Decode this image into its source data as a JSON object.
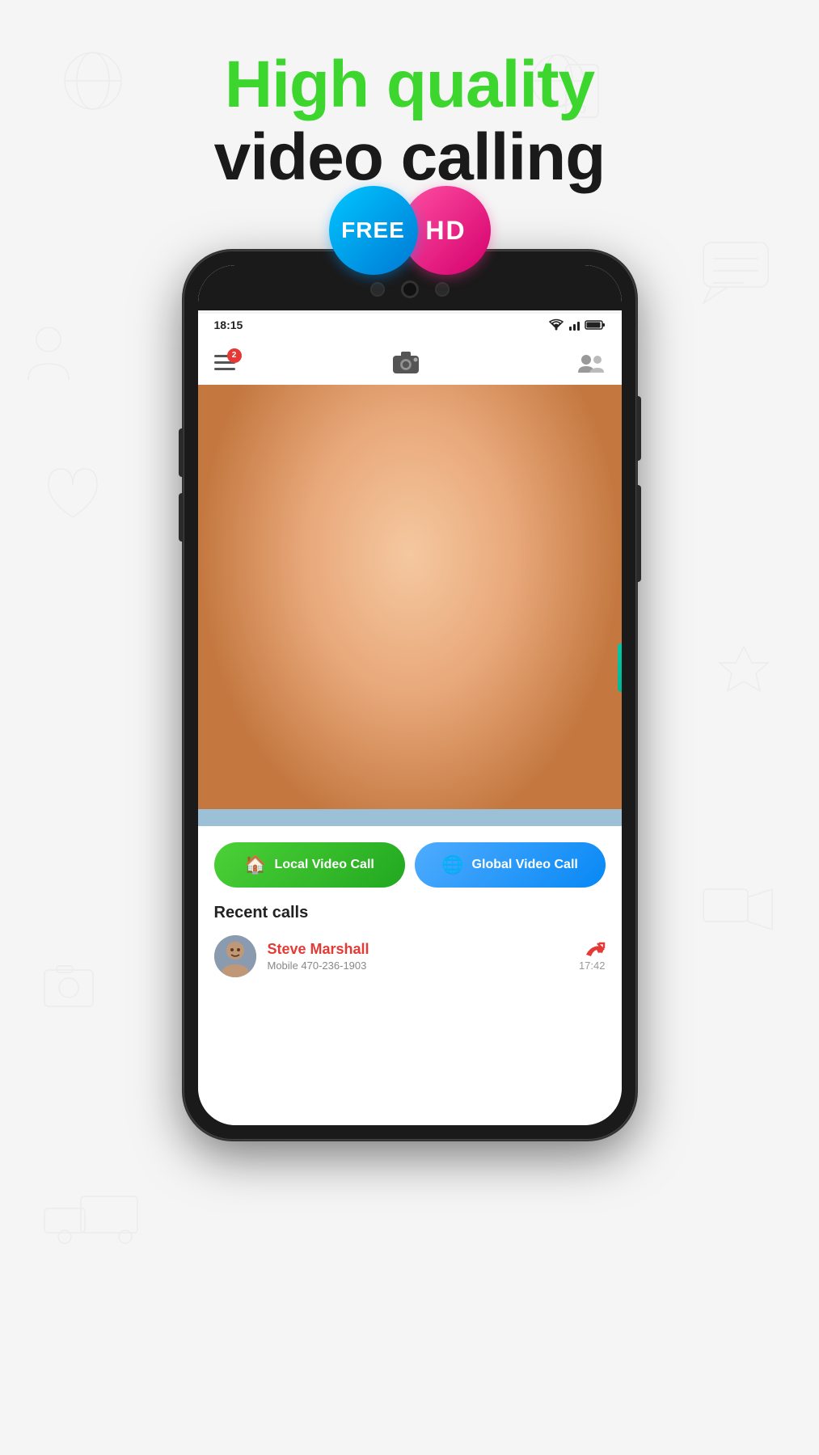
{
  "header": {
    "high_quality": "High quality",
    "video_calling": "video calling"
  },
  "badges": {
    "free_label": "FREE",
    "hd_label": "HD"
  },
  "phone": {
    "status_bar": {
      "time": "18:15",
      "signal": "●●●",
      "wifi": "▲",
      "battery": "▪"
    },
    "app_header": {
      "notification_count": "2",
      "menu_icon": "☰",
      "camera_icon": "📷",
      "contacts_icon": "👥"
    },
    "bottom_panel": {
      "local_call_label": "Local Video Call",
      "global_call_label": "Global Video Call",
      "recent_calls_title": "Recent calls",
      "recent_calls": [
        {
          "name": "Steve Marshall",
          "detail": "Mobile 470-236-1903",
          "time": "17:42",
          "status": "missed"
        }
      ]
    }
  },
  "colors": {
    "green_accent": "#3dd62e",
    "dark_text": "#1a1a1a",
    "badge_free_bg": "#00aaff",
    "badge_hd_bg": "#ff3fa3",
    "btn_local_green": "#4cd137",
    "btn_global_blue": "#4facfe",
    "missed_call_color": "#e53935",
    "contact_name_color": "#e53935"
  }
}
